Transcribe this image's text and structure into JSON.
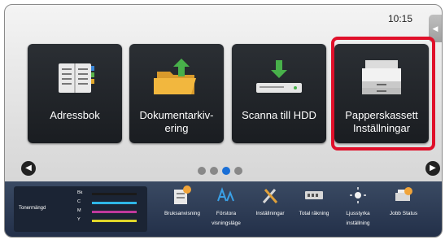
{
  "status": {
    "time": "10:15",
    "side_tab_glyph": "◀"
  },
  "tiles": [
    {
      "label": "Adressbok",
      "icon": "address-book-icon"
    },
    {
      "label": "Dokumentarkiv-\nering",
      "icon": "document-filing-icon"
    },
    {
      "label": "Scanna till HDD",
      "icon": "scan-to-hdd-icon"
    },
    {
      "label": "Papperskassett\nInställningar",
      "icon": "paper-tray-settings-icon",
      "highlighted": true
    }
  ],
  "pager": {
    "total": 4,
    "active": 3
  },
  "nav": {
    "prev_glyph": "◀",
    "next_glyph": "▶"
  },
  "toner": {
    "title": "Tonermängd",
    "rows": [
      {
        "label": "Bk",
        "color": "#1a1a1a"
      },
      {
        "label": "C",
        "color": "#2fb6e6"
      },
      {
        "label": "M",
        "color": "#c0399b"
      },
      {
        "label": "Y",
        "color": "#e0d62a"
      }
    ]
  },
  "tools": [
    {
      "label": "Bruksanvisning",
      "icon": "manual-icon"
    },
    {
      "label": "Förstora\nvisningsläge",
      "icon": "magnify-display-icon"
    },
    {
      "label": "Inställningar",
      "icon": "tools-settings-icon"
    },
    {
      "label": "Total räkning",
      "icon": "counter-icon"
    },
    {
      "label": "Ljusstyrka\ninställning",
      "icon": "brightness-icon"
    },
    {
      "label": "Jobb Status",
      "icon": "job-status-icon"
    }
  ],
  "colors": {
    "accent": "#1a6fd6",
    "highlight": "#e0102a",
    "tile": "#1f2327",
    "bar": "#2b3a55"
  }
}
